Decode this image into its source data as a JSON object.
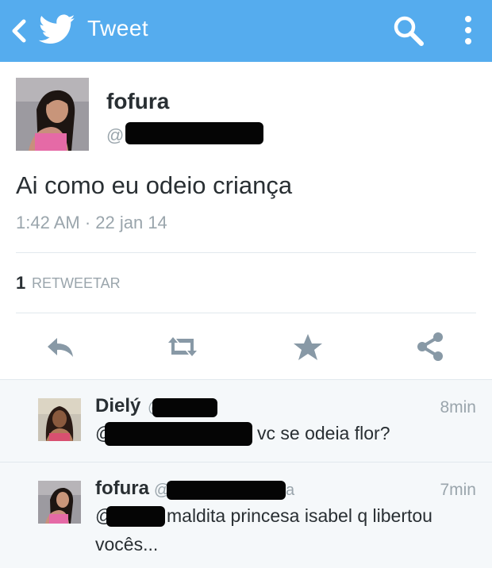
{
  "header": {
    "title": "Tweet",
    "back_icon": "chevron-left-icon",
    "logo_icon": "twitter-bird-icon",
    "search_icon": "search-icon",
    "menu_icon": "more-vertical-icon",
    "accent": "#55acee"
  },
  "tweet": {
    "author_name": "fofura",
    "handle_prefix": "@",
    "text": "Ai como eu odeio criança",
    "timestamp": "1:42 AM · 22 jan 14",
    "retweet_count": "1",
    "retweet_label": "RETWEETAR"
  },
  "actions": {
    "reply_icon": "reply-icon",
    "retweet_icon": "retweet-icon",
    "favorite_icon": "star-icon",
    "share_icon": "share-icon"
  },
  "replies": [
    {
      "author_name": "Dielý",
      "handle_prefix": "@",
      "time": "8min",
      "mention_prefix": "@",
      "text": "vc se odeia flor?"
    },
    {
      "author_name": "fofura",
      "handle_prefix": "@",
      "handle_suffix": "a",
      "time": "7min",
      "mention_prefix": "@",
      "text_line1": "maldita princesa isabel q libertou",
      "text_line2": "vocês..."
    }
  ]
}
